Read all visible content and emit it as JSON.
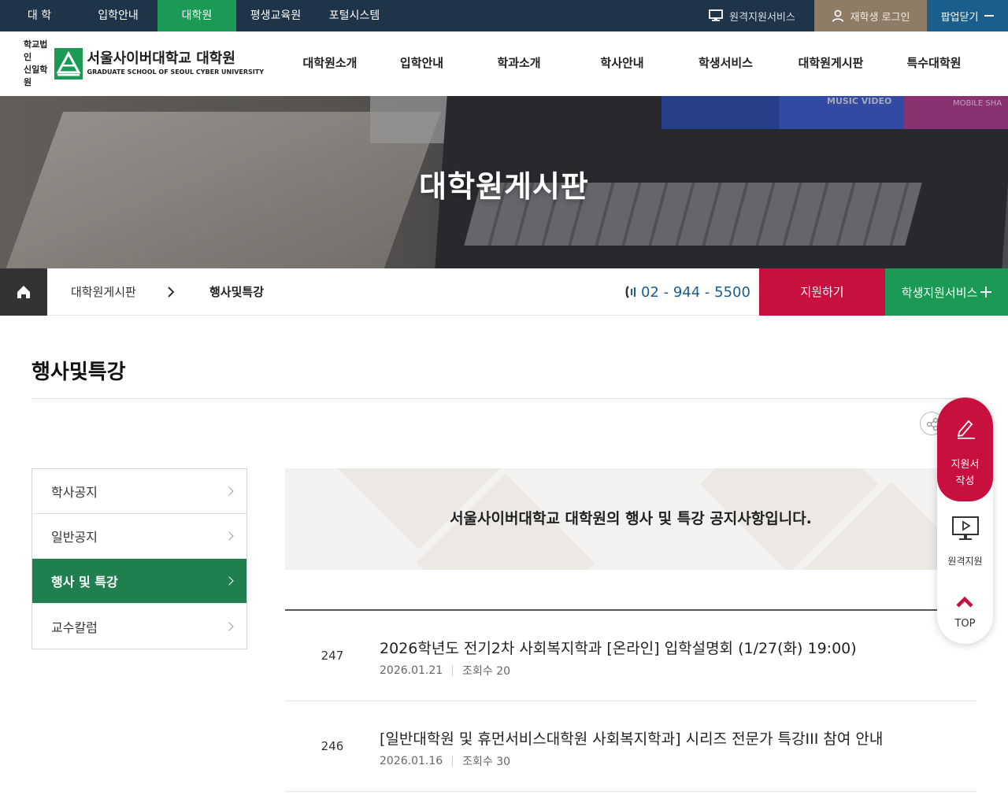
{
  "topbar": {
    "links": [
      {
        "label": "대 학",
        "width": 100
      },
      {
        "label": "입학안내",
        "width": 100
      },
      {
        "label": "대학원",
        "width": 100
      },
      {
        "label": "평생교육원",
        "width": 100
      },
      {
        "label": "포털시스템",
        "width": 100
      }
    ],
    "remote_service": "원격지원서비스",
    "student_login": "재학생 로그인",
    "popup_close": "팝업닫기"
  },
  "header": {
    "logo": {
      "corp_line1": "학교법인",
      "corp_line2": "신일학원",
      "name_ko": "서울사이버대학교 대학원",
      "name_en": "GRADUATE SCHOOL OF SEOUL CYBER UNIVERSITY"
    },
    "gnb": [
      "대학원소개",
      "입학안내",
      "학과소개",
      "학사안내",
      "학생서비스",
      "대학원게시판",
      "특수대학원"
    ]
  },
  "hero": {
    "title": "대학원게시판",
    "screen_text_1": "MUSIC VIDEO",
    "screen_text_2": "MOBILE SHA"
  },
  "location": {
    "crumb1": "대학원게시판",
    "crumb2": "행사및특강",
    "phone": "02 - 944 - 5500",
    "apply": "지원하기",
    "student_service": "학생지원서비스"
  },
  "page": {
    "title": "행사및특강"
  },
  "side_menu": {
    "items": [
      {
        "label": "학사공지",
        "active": false
      },
      {
        "label": "일반공지",
        "active": false
      },
      {
        "label": "행사 및 특강",
        "active": true
      },
      {
        "label": "교수칼럼",
        "active": false
      }
    ]
  },
  "intro": {
    "text": "서울사이버대학교 대학원의 행사 및 특강 공지사항입니다."
  },
  "posts": [
    {
      "no": "247",
      "subject": "2026학년도 전기2차 사회복지학과 [온라인] 입학설명회 (1/27(화) 19:00)",
      "date": "2026.01.21",
      "views": "조회수 20"
    },
    {
      "no": "246",
      "subject": "[일반대학원 및 휴먼서비스대학원 사회복지학과] 시리즈 전문가 특강III 참여 안내",
      "date": "2026.01.16",
      "views": "조회수 30"
    }
  ],
  "quick_menu": {
    "write_application": "지원서\n작성",
    "write_line1": "지원서",
    "write_line2": "작성",
    "remote_support": "원격지원",
    "top": "TOP"
  },
  "colors": {
    "topbar": "#1f3349",
    "green": "#1b9a55",
    "red": "#c8103e",
    "brown": "#8e7c66",
    "blue": "#1a5e8e"
  }
}
